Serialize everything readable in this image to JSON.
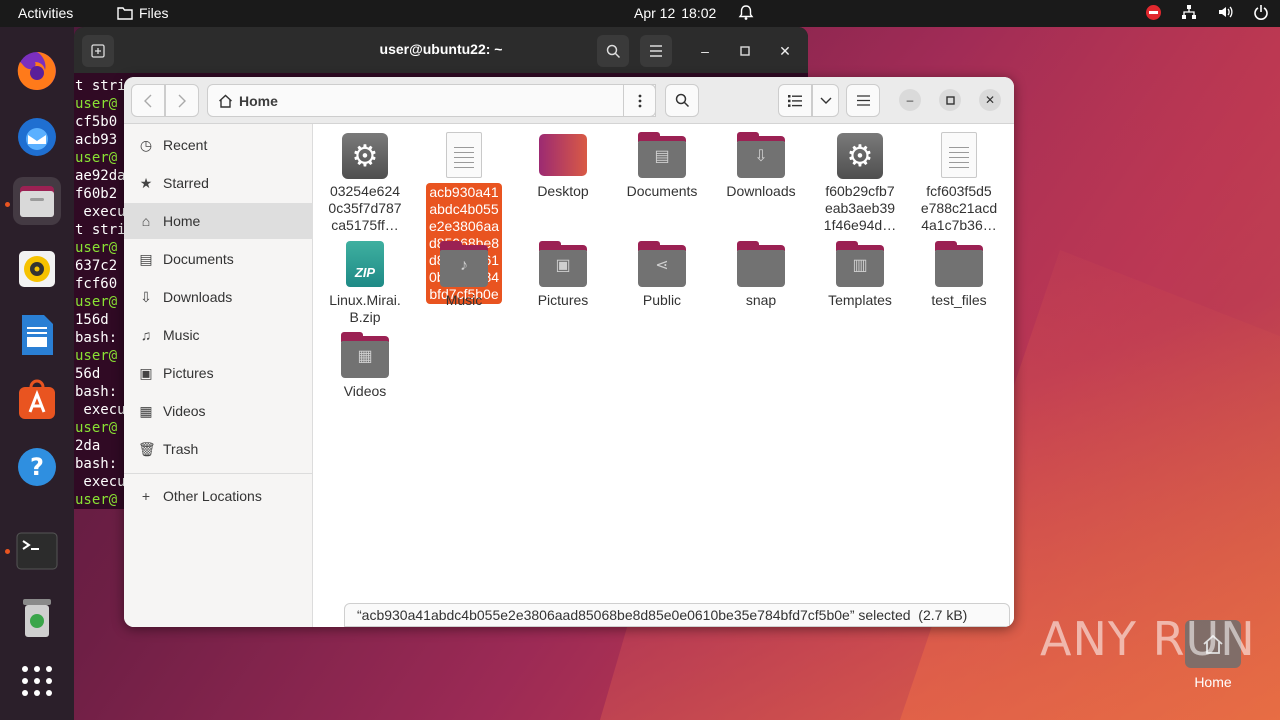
{
  "topbar": {
    "activities": "Activities",
    "app_name": "Files",
    "date": "Apr 12",
    "time": "18:02"
  },
  "terminal": {
    "title": "user@ubuntu22: ~",
    "lines": [
      "t stri",
      "user@",
      "cf5b0",
      "acb93",
      "user@",
      "ae92da",
      "f60b2",
      " execu",
      "t stri",
      "user@",
      "637c2",
      "fcf60",
      "user@",
      "156d",
      "bash:",
      "user@",
      "56d",
      "bash:",
      " execu",
      "user@",
      "2da",
      "bash:",
      " execu",
      "user@"
    ]
  },
  "files": {
    "path_label": "Home",
    "sidebar": [
      {
        "label": "Recent",
        "icon": "clock-icon"
      },
      {
        "label": "Starred",
        "icon": "star-icon"
      },
      {
        "label": "Home",
        "icon": "home-icon"
      },
      {
        "label": "Documents",
        "icon": "document-icon"
      },
      {
        "label": "Downloads",
        "icon": "download-icon"
      },
      {
        "label": "Music",
        "icon": "music-icon"
      },
      {
        "label": "Pictures",
        "icon": "picture-icon"
      },
      {
        "label": "Videos",
        "icon": "video-icon"
      },
      {
        "label": "Trash",
        "icon": "trash-icon"
      },
      {
        "label": "Other Locations",
        "icon": "plus-icon"
      }
    ],
    "items": [
      {
        "name": "03254e624\n0c35f7d787\nca5175ff…",
        "type": "executable"
      },
      {
        "name": "acb930a41\nabdc4b055\ne2e3806aa\nd85068be8\nd85e0e061\n0be35e784\nbfd7cf5b0e",
        "type": "text",
        "selected": true
      },
      {
        "name": "Desktop",
        "type": "desktop-folder"
      },
      {
        "name": "Documents",
        "type": "folder"
      },
      {
        "name": "Downloads",
        "type": "folder"
      },
      {
        "name": "f60b29cfb7\neab3aeb39\n1f46e94d…",
        "type": "executable"
      },
      {
        "name": "fcf603f5d5\ne788c21acd\n4a1c7b36…",
        "type": "text"
      },
      {
        "name": "Linux.Mirai.\nB.zip",
        "type": "zip"
      },
      {
        "name": "Music",
        "type": "folder"
      },
      {
        "name": "Pictures",
        "type": "folder"
      },
      {
        "name": "Public",
        "type": "folder"
      },
      {
        "name": "snap",
        "type": "folder"
      },
      {
        "name": "Templates",
        "type": "folder"
      },
      {
        "name": "test_files",
        "type": "folder"
      },
      {
        "name": "Videos",
        "type": "folder"
      }
    ],
    "status": "“acb930a41abdc4b055e2e3806aad85068be8d85e0e0610be35e784bfd7cf5b0e” selected  (2.7 kB)"
  },
  "desktop": {
    "home_label": "Home"
  },
  "watermark": "ANY RUN",
  "colors": {
    "accent": "#e95420",
    "folder_tab": "#9b2153",
    "terminal_bg": "#300a24",
    "prompt_green": "#8ae234"
  }
}
